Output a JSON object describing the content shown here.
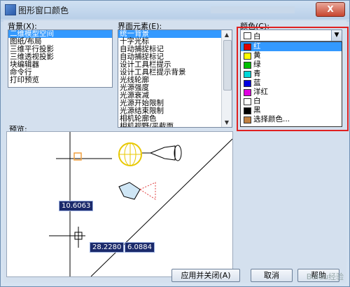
{
  "window": {
    "title": "图形窗口颜色",
    "close_label": "X"
  },
  "background": {
    "label": "背景(X):",
    "items": [
      "二维模型空间",
      "图纸/布局",
      "三维平行投影",
      "三维透视投影",
      "块编辑器",
      "命令行",
      "打印预览"
    ],
    "selected_index": 0
  },
  "interface_elements": {
    "label": "界面元素(E):",
    "items": [
      "统一背景",
      "十字光标",
      "自动捕捉标记",
      "自动捕捉标记",
      "设计工具栏提示",
      "设计工具栏提示背景",
      "光线轮廓",
      "光源强度",
      "光源衰减",
      "光源开始限制",
      "光源结束限制",
      "相机轮廓色",
      "相机视野/平截面"
    ],
    "selected_index": 0
  },
  "color": {
    "label": "颜色(C):",
    "current": "白",
    "options": [
      {
        "name": "红",
        "swatch": "#e00000"
      },
      {
        "name": "黄",
        "swatch": "#ffff00"
      },
      {
        "name": "绿",
        "swatch": "#00c000"
      },
      {
        "name": "青",
        "swatch": "#00d8d8"
      },
      {
        "name": "蓝",
        "swatch": "#0000e0"
      },
      {
        "name": "洋红",
        "swatch": "#e000e0"
      },
      {
        "name": "白",
        "swatch": "#ffffff"
      },
      {
        "name": "黑",
        "swatch": "#000000"
      },
      {
        "name": "选择颜色...",
        "swatch": "#c08040"
      }
    ],
    "highlighted_index": 0
  },
  "preview": {
    "label": "预览:",
    "values": [
      "10.6063",
      "28.2280",
      "6.0884"
    ]
  },
  "buttons": {
    "apply_close": "应用并关闭(A)",
    "cancel": "取消",
    "help": "帮助"
  },
  "watermark": "Baidu经验"
}
